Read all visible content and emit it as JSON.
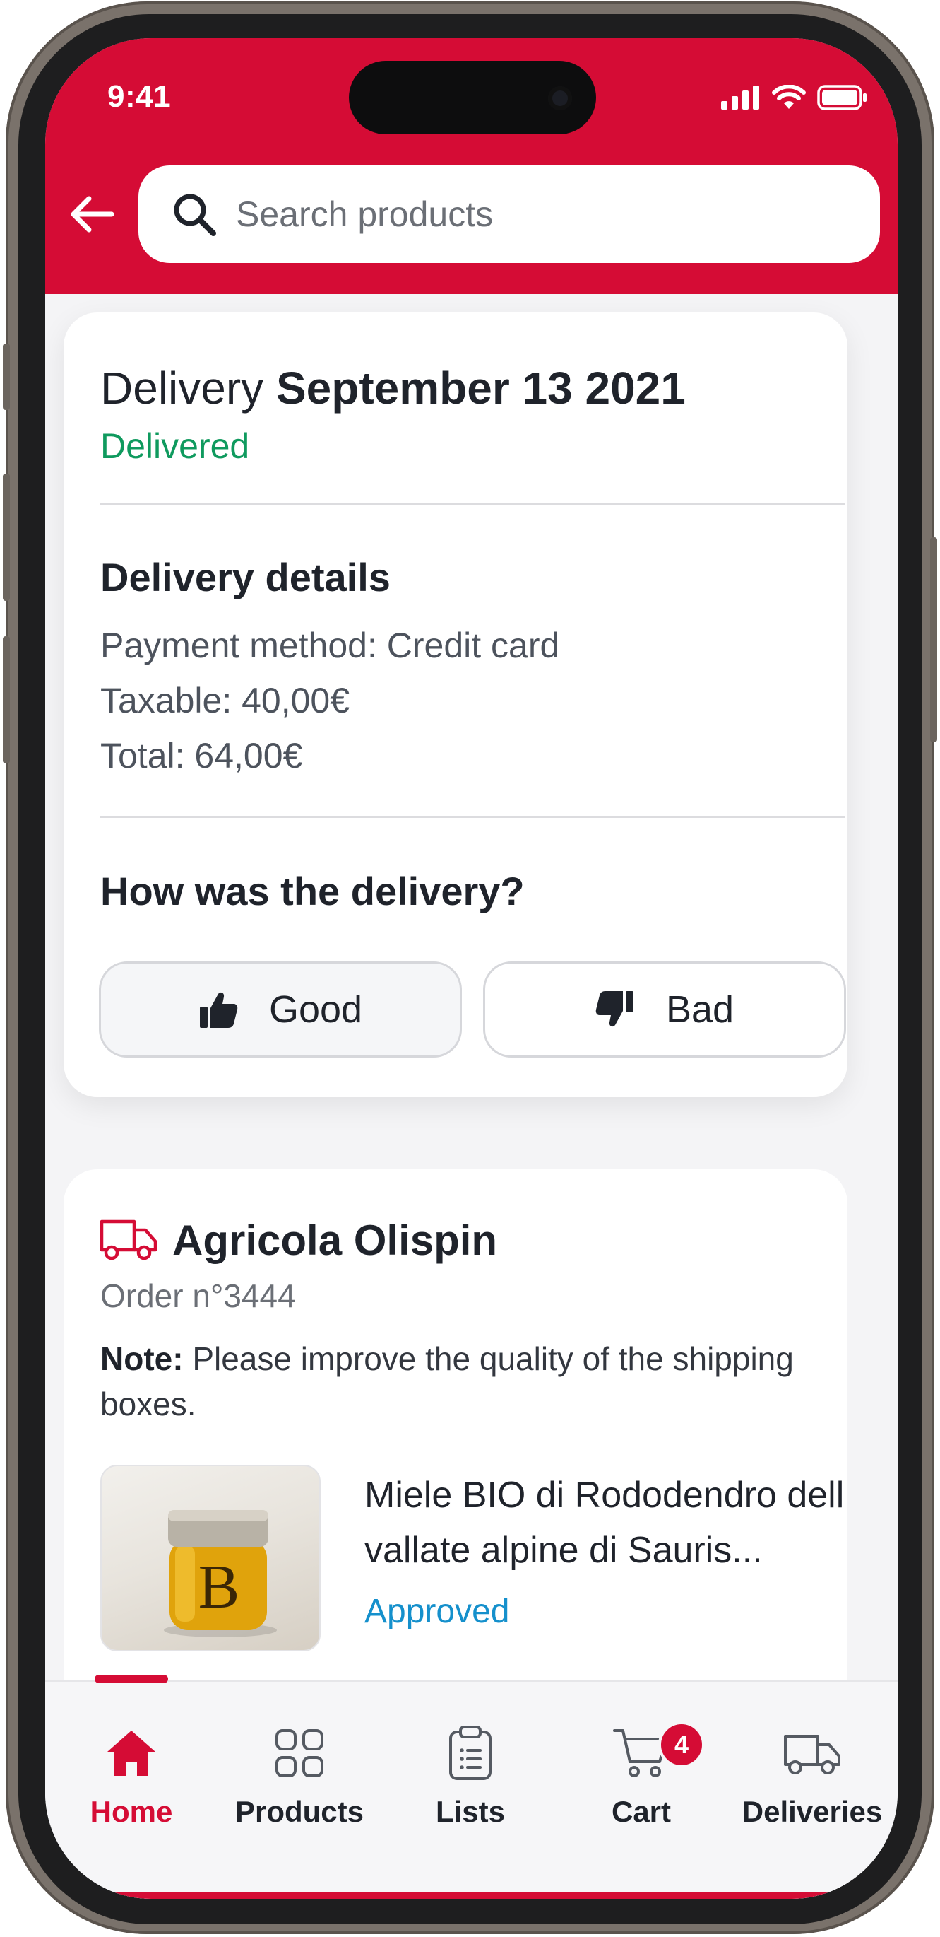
{
  "status_bar": {
    "time": "9:41"
  },
  "header": {
    "search_placeholder": "Search products"
  },
  "delivery": {
    "title_prefix": "Delivery",
    "date": "September 13 2021",
    "status": "Delivered",
    "details_title": "Delivery details",
    "payment": "Payment method: Credit card",
    "taxable": "Taxable: 40,00€",
    "total": "Total: 64,00€",
    "feedback_title": "How was the delivery?",
    "good_label": "Good",
    "bad_label": "Bad"
  },
  "order": {
    "supplier": "Agricola Olispin",
    "order_number": "Order n°3444",
    "note_label": "Note:",
    "note_text": " Please improve the quality of the shipping boxes.",
    "product_name": "Miele BIO di Rododendro dell vallate alpine di Sauris...",
    "product_status": "Approved",
    "jar_letter": "B"
  },
  "nav": {
    "home": "Home",
    "products": "Products",
    "lists": "Lists",
    "cart": "Cart",
    "cart_count": "4",
    "deliveries": "Deliveries"
  },
  "colors": {
    "brand": "#d50c35",
    "delivered": "#0f9a5e",
    "approved": "#1590cc"
  }
}
